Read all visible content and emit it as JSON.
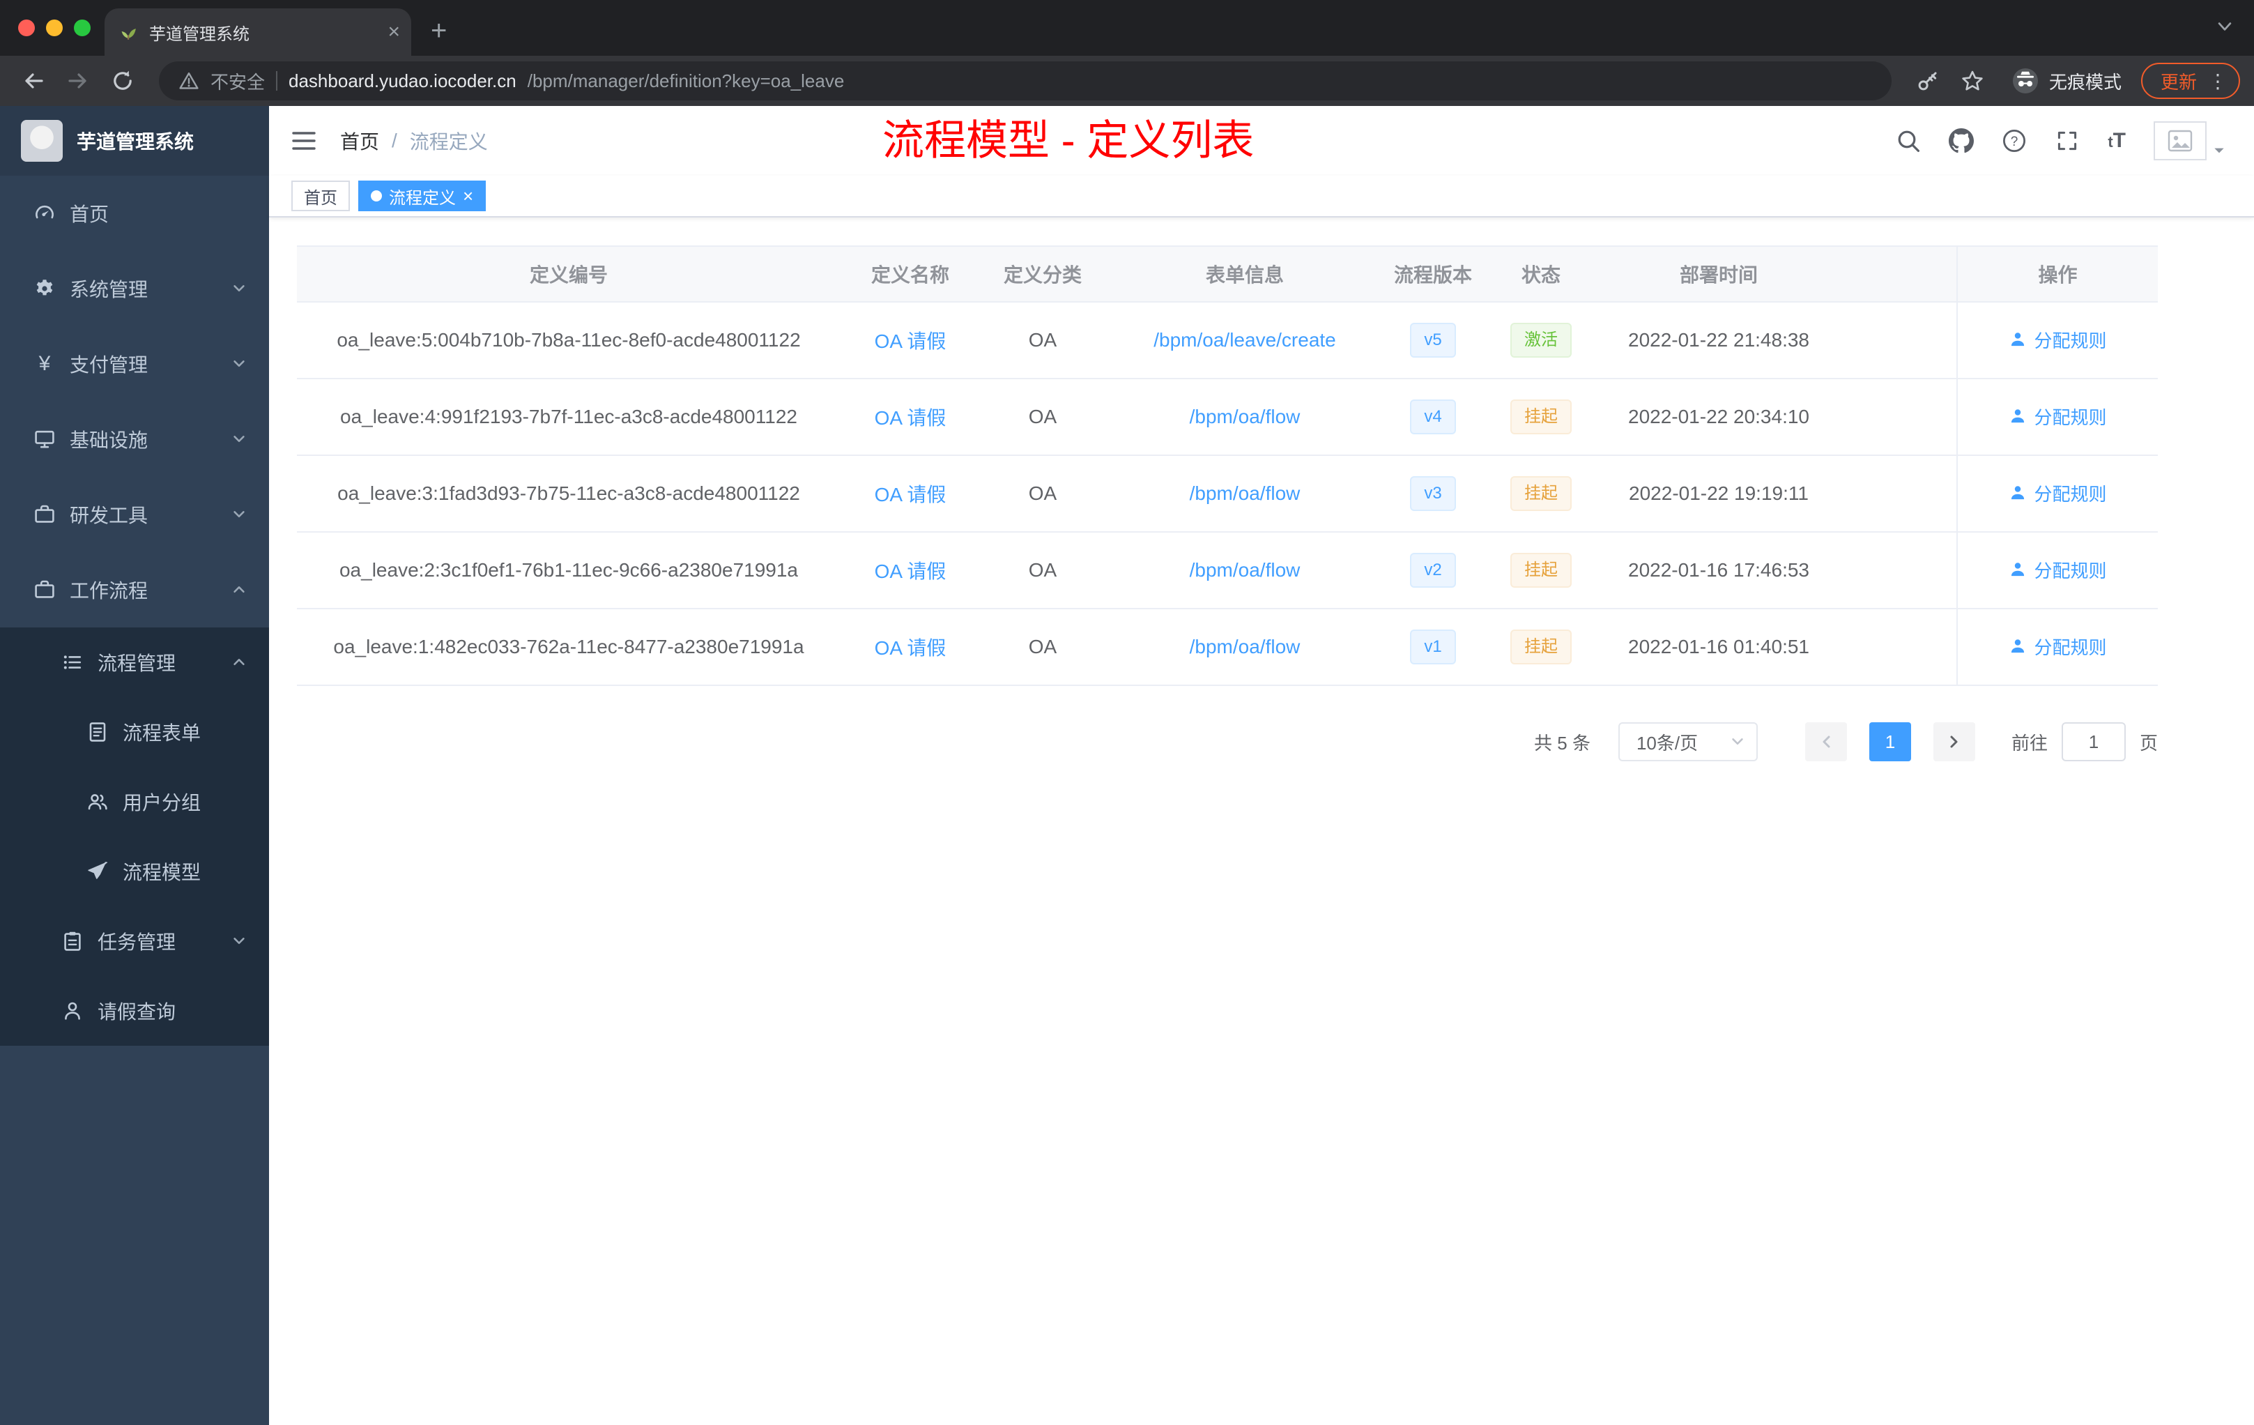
{
  "browser": {
    "tab_title": "芋道管理系统",
    "not_secure": "不安全",
    "url_host": "dashboard.yudao.iocoder.cn",
    "url_path": "/bpm/manager/definition?key=oa_leave",
    "incognito": "无痕模式",
    "update": "更新"
  },
  "sidebar": {
    "logo_title": "芋道管理系统",
    "home": "首页",
    "system": "系统管理",
    "payment": "支付管理",
    "infra": "基础设施",
    "devtools": "研发工具",
    "workflow": "工作流程",
    "process_mgmt": "流程管理",
    "process_form": "流程表单",
    "user_group": "用户分组",
    "process_model": "流程模型",
    "task_mgmt": "任务管理",
    "leave_query": "请假查询"
  },
  "header": {
    "breadcrumb_home": "首页",
    "breadcrumb_sep": "/",
    "breadcrumb_current": "流程定义",
    "annotation": "流程模型 - 定义列表"
  },
  "tags": {
    "home": "首页",
    "active": "流程定义"
  },
  "table": {
    "columns": {
      "id": "定义编号",
      "name": "定义名称",
      "category": "定义分类",
      "form": "表单信息",
      "version": "流程版本",
      "status": "状态",
      "deploy_time": "部署时间",
      "action": "操作"
    },
    "rows": [
      {
        "id": "oa_leave:5:004b710b-7b8a-11ec-8ef0-acde48001122",
        "name": "OA 请假",
        "category": "OA",
        "form": "/bpm/oa/leave/create",
        "version": "v5",
        "status": "激活",
        "status_type": "success",
        "deploy_time": "2022-01-22 21:48:38",
        "action": "分配规则"
      },
      {
        "id": "oa_leave:4:991f2193-7b7f-11ec-a3c8-acde48001122",
        "name": "OA 请假",
        "category": "OA",
        "form": "/bpm/oa/flow",
        "version": "v4",
        "status": "挂起",
        "status_type": "warning",
        "deploy_time": "2022-01-22 20:34:10",
        "action": "分配规则"
      },
      {
        "id": "oa_leave:3:1fad3d93-7b75-11ec-a3c8-acde48001122",
        "name": "OA 请假",
        "category": "OA",
        "form": "/bpm/oa/flow",
        "version": "v3",
        "status": "挂起",
        "status_type": "warning",
        "deploy_time": "2022-01-22 19:19:11",
        "action": "分配规则"
      },
      {
        "id": "oa_leave:2:3c1f0ef1-76b1-11ec-9c66-a2380e71991a",
        "name": "OA 请假",
        "category": "OA",
        "form": "/bpm/oa/flow",
        "version": "v2",
        "status": "挂起",
        "status_type": "warning",
        "deploy_time": "2022-01-16 17:46:53",
        "action": "分配规则"
      },
      {
        "id": "oa_leave:1:482ec033-762a-11ec-8477-a2380e71991a",
        "name": "OA 请假",
        "category": "OA",
        "form": "/bpm/oa/flow",
        "version": "v1",
        "status": "挂起",
        "status_type": "warning",
        "deploy_time": "2022-01-16 01:40:51",
        "action": "分配规则"
      }
    ]
  },
  "pagination": {
    "total": "共 5 条",
    "page_size": "10条/页",
    "current_page": "1",
    "goto_label": "前往",
    "goto_value": "1",
    "page_unit": "页"
  },
  "colors": {
    "accent": "#409eff",
    "success": "#67c23a",
    "warning": "#e6a23c",
    "annotation": "#ff0000",
    "sidebar_bg": "#304156",
    "submenu_bg": "#1f2d3d"
  }
}
